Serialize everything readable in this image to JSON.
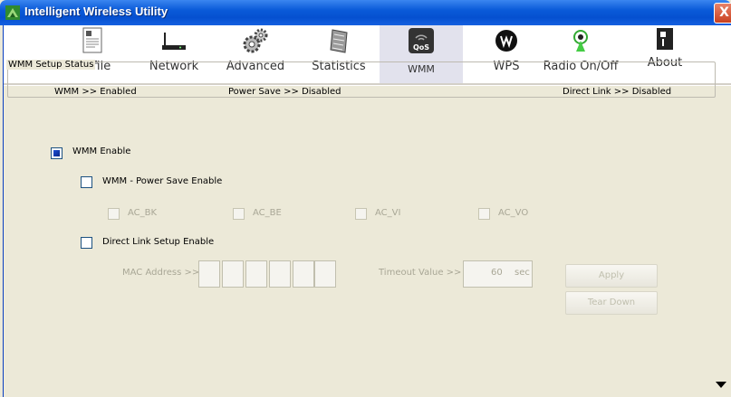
{
  "window": {
    "title": "Intelligent Wireless Utility",
    "close_label": "X"
  },
  "toolbar": {
    "items": [
      {
        "label": "Profile",
        "icon": "profile-icon"
      },
      {
        "label": "Network",
        "icon": "network-icon"
      },
      {
        "label": "Advanced",
        "icon": "advanced-icon"
      },
      {
        "label": "Statistics",
        "icon": "statistics-icon"
      },
      {
        "label": "WMM",
        "icon": "qos-icon",
        "badge": "QoS",
        "active": true
      },
      {
        "label": "WPS",
        "icon": "wps-icon"
      },
      {
        "label": "Radio On/Off",
        "icon": "radio-icon"
      },
      {
        "label": "About",
        "icon": "about-icon"
      }
    ]
  },
  "status": {
    "legend": "WMM Setup Status",
    "wmm": "WMM >> Enabled",
    "power_save": "Power Save >> Disabled",
    "direct_link": "Direct Link >> Disabled"
  },
  "wmm_enable": {
    "label": "WMM Enable",
    "checked": true
  },
  "power_save_enable": {
    "label": "WMM - Power Save Enable",
    "checked": false
  },
  "ac": {
    "bk": "AC_BK",
    "be": "AC_BE",
    "vi": "AC_VI",
    "vo": "AC_VO"
  },
  "direct_link_enable": {
    "label": "Direct Link Setup Enable",
    "checked": false
  },
  "mac_address_label": "MAC Address >>",
  "timeout": {
    "label": "Timeout Value >>",
    "value": "60",
    "unit": "sec"
  },
  "buttons": {
    "apply": "Apply",
    "tear_down": "Tear Down"
  },
  "colors": {
    "title_bar": "#0a5ad8",
    "active_tab": "#e2e2ed",
    "panel": "#ece9d8"
  }
}
